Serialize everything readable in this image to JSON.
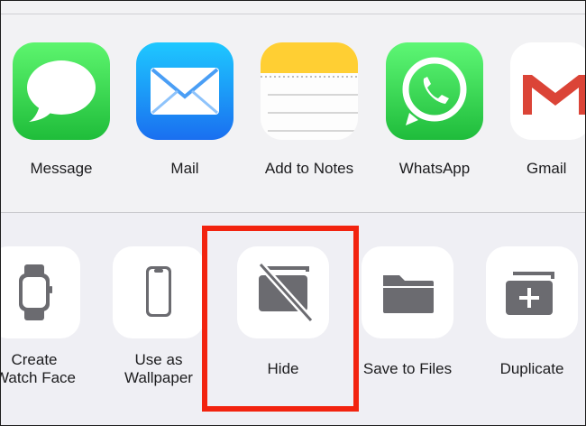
{
  "share_sheet": {
    "apps": [
      {
        "label": "Message",
        "icon": "messages-icon"
      },
      {
        "label": "Mail",
        "icon": "mail-icon"
      },
      {
        "label": "Add to Notes",
        "icon": "notes-icon"
      },
      {
        "label": "WhatsApp",
        "icon": "whatsapp-icon"
      },
      {
        "label": "Gmail",
        "icon": "gmail-icon"
      }
    ],
    "actions": [
      {
        "label_line1": "Create",
        "label_line2": "Watch Face",
        "icon": "watch-icon"
      },
      {
        "label_line1": "Use as",
        "label_line2": "Wallpaper",
        "icon": "phone-icon"
      },
      {
        "label": "Hide",
        "icon": "hide-photo-icon"
      },
      {
        "label": "Save to Files",
        "icon": "folder-icon"
      },
      {
        "label": "Duplicate",
        "icon": "duplicate-icon"
      }
    ]
  },
  "colors": {
    "messages_green": "#34c759",
    "mail_blue": "#1e8ef7",
    "notes_yellow": "#ffd23f",
    "whatsapp_green": "#25d366",
    "gmail_red": "#db4437",
    "highlight_red": "#f2230f",
    "glyph_gray": "#6b6b70"
  }
}
